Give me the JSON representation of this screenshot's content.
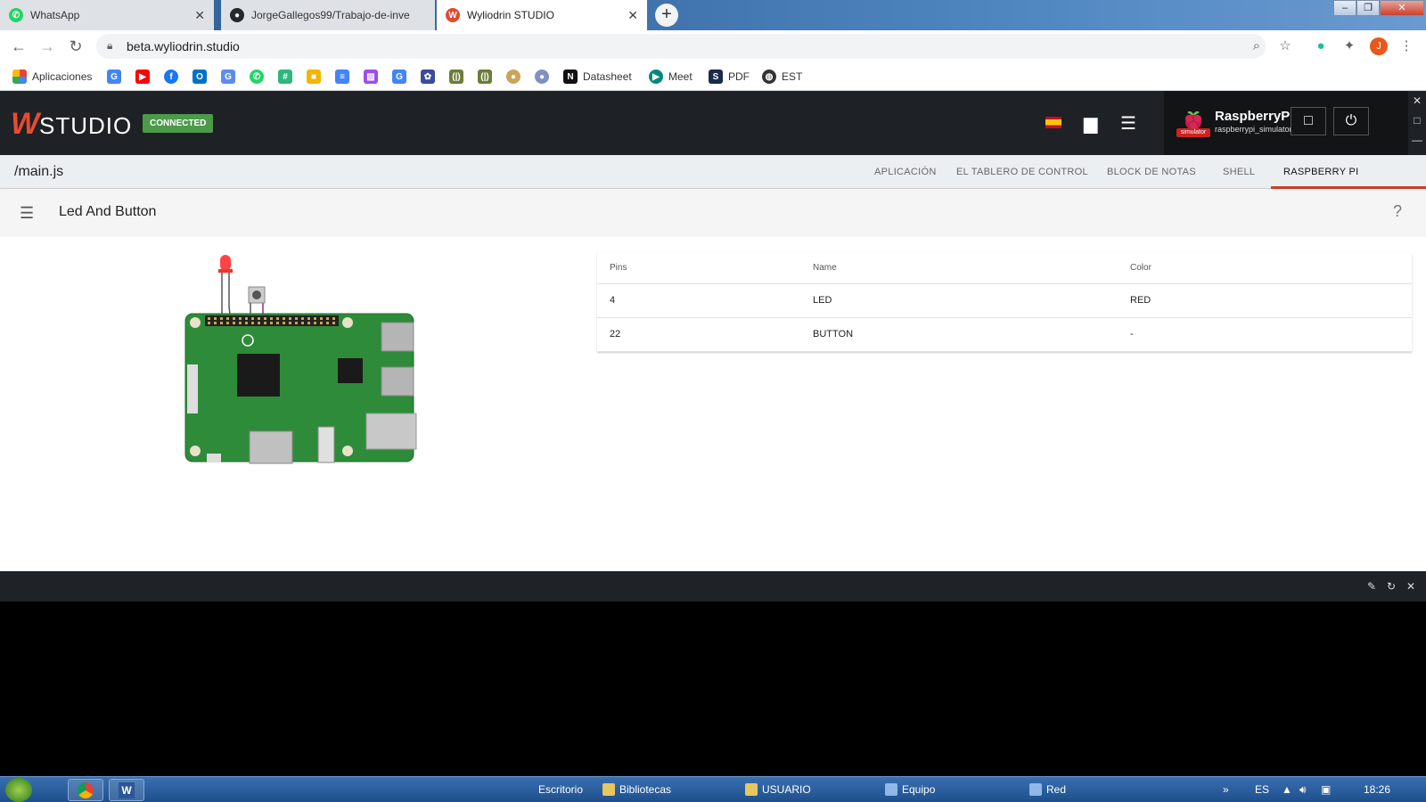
{
  "browser": {
    "tabs": [
      {
        "title": "WhatsApp",
        "favicon": "whatsapp-icon",
        "active": false
      },
      {
        "title": "JorgeGallegos99/Trabajo-de-inve",
        "favicon": "github-icon",
        "active": false
      },
      {
        "title": "Wyliodrin STUDIO",
        "favicon": "wyliodrin-icon",
        "active": true
      }
    ],
    "url": "beta.wyliodrin.studio",
    "profile_initial": "J",
    "bookmarks": [
      {
        "label": "Aplicaciones",
        "icon": "apps-grid-icon"
      },
      {
        "label": "",
        "icon": "google-icon"
      },
      {
        "label": "",
        "icon": "youtube-icon"
      },
      {
        "label": "",
        "icon": "facebook-icon"
      },
      {
        "label": "",
        "icon": "outlook-icon"
      },
      {
        "label": "",
        "icon": "translate-icon"
      },
      {
        "label": "",
        "icon": "whatsapp-icon"
      },
      {
        "label": "",
        "icon": "slack-icon"
      },
      {
        "label": "",
        "icon": "classroom-icon"
      },
      {
        "label": "",
        "icon": "docs-icon"
      },
      {
        "label": "",
        "icon": "jamboard-icon"
      },
      {
        "label": "",
        "icon": "google-icon"
      },
      {
        "label": "",
        "icon": "settings-icon"
      },
      {
        "label": "",
        "icon": "bookmark-icon"
      },
      {
        "label": "",
        "icon": "bookmark-icon"
      },
      {
        "label": "",
        "icon": "bookmark-icon"
      },
      {
        "label": "",
        "icon": "bookmark-icon"
      },
      {
        "label": "Datasheet",
        "icon": "n-icon"
      },
      {
        "label": "Meet",
        "icon": "meet-icon"
      },
      {
        "label": "PDF",
        "icon": "pdf-icon"
      },
      {
        "label": "EST",
        "icon": "globe-icon"
      }
    ]
  },
  "studio": {
    "logo_text": "STUDIO",
    "status_badge": "CONNECTED",
    "device": {
      "name": "RaspberryPi",
      "id": "raspberrypi_simulator",
      "tag": "simulator"
    },
    "filename": "/main.js",
    "tabs": [
      {
        "label": "APLICACIÓN",
        "active": false
      },
      {
        "label": "EL TABLERO DE CONTROL",
        "active": false
      },
      {
        "label": "BLOCK DE NOTAS",
        "active": false
      },
      {
        "label": "SHELL",
        "active": false
      },
      {
        "label": "RASPBERRY PI SIMULATOR",
        "active": true
      }
    ],
    "project_title": "Led And Button",
    "help_label": "?",
    "pins_table": {
      "headers": [
        "Pins",
        "Name",
        "Color"
      ],
      "rows": [
        [
          "4",
          "LED",
          "RED"
        ],
        [
          "22",
          "BUTTON",
          "-"
        ]
      ]
    }
  },
  "taskbar": {
    "items": [
      "Escritorio",
      "Bibliotecas",
      "USUARIO",
      "Equipo",
      "Red"
    ],
    "language": "ES",
    "time": "18:26"
  },
  "colors": {
    "accent": "#d23c2a",
    "connected": "#4c9a4a",
    "header_bg": "#1e2125",
    "board_green": "#2e8b3a"
  }
}
